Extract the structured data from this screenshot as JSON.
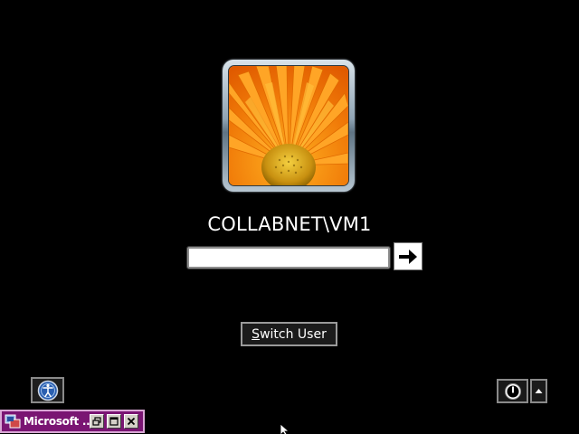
{
  "user": {
    "name": "COLLABNET\\VM1",
    "picture_icon": "orange-gerbera-flower"
  },
  "password": {
    "value": "",
    "placeholder": ""
  },
  "submit": {
    "icon": "arrow-right-icon"
  },
  "switch_user": {
    "label_first": "S",
    "label_rest": "witch User",
    "full_label": "Switch User"
  },
  "ease_of_access": {
    "icon": "ease-of-access-icon"
  },
  "shutdown": {
    "icon": "power-icon",
    "options_icon": "triangle-up-icon"
  },
  "minimized_window": {
    "title": "Microsoft ...",
    "buttons": [
      "restore",
      "maximize",
      "close"
    ],
    "background": "#7a1573"
  },
  "colors": {
    "background": "#000000",
    "text": "#ffffff",
    "flower_orange": "#f08a10"
  }
}
